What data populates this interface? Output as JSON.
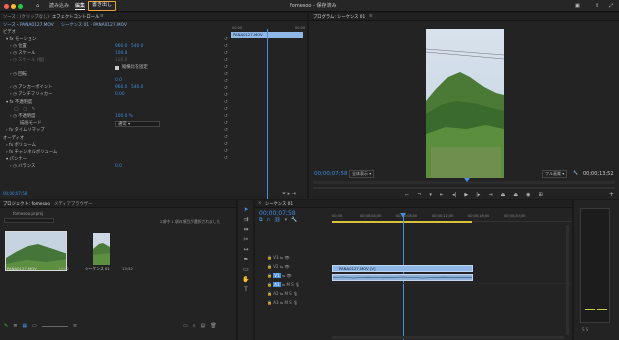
{
  "app": {
    "project_name": "fomesoo",
    "save_status": "保存済み",
    "title_combined": "fomesoo - 保存済み"
  },
  "menu": {
    "home_icon": "home-icon",
    "import_label": "読み込み",
    "edit_label": "編集",
    "export_label": "書き出し"
  },
  "effect_controls": {
    "tab_source": "ソース : (クリップなし)",
    "tab_effect": "エフェクトコントロール",
    "breadcrumb": "ソース・PANA0127.MOV",
    "sequence_ref": "シーケンス 01 · PANA0127.MOV",
    "time_start": "00:00",
    "time_end": "00:00",
    "clip_label": "PANA0127.MOV",
    "video_header": "ビデオ",
    "motion_label": "モーション",
    "position_label": "位置",
    "position_x": "960.0",
    "position_y": "540.0",
    "scale_label": "スケール",
    "scale_value": "100.0",
    "scale_width_label": "スケール (幅)",
    "scale_width_value": "100.0",
    "uniform_scale_label": "縦横比を固定",
    "rotation_label": "回転",
    "rotation_value": "0.0",
    "anchor_label": "アンカーポイント",
    "anchor_x": "960.0",
    "anchor_y": "540.0",
    "antiflicker_label": "アンチフリッカー",
    "antiflicker_value": "0.00",
    "opacity_label": "不透明度",
    "opacity_value_label": "不透明度",
    "opacity_value": "100.0 %",
    "blend_label": "描画モード",
    "blend_value": "通常",
    "time_remap_label": "タイムリマップ",
    "audio_header": "オーディオ",
    "volume_label": "ボリューム",
    "channel_volume_label": "チャンネルボリューム",
    "panner_label": "パンナー",
    "balance_label": "バランス",
    "balance_value": "0.0",
    "current_time": "00;00;07;58"
  },
  "program": {
    "title": "プログラム: シーケンス 01",
    "timecode": "00;00;07;58",
    "fit_label": "全体表示",
    "quality_label": "フル画質",
    "duration": "00;00;13;52"
  },
  "project": {
    "tab_project": "プロジェクト: fomesoo",
    "tab_media": "メディアブラウザー",
    "file_name": "fomesoo.prproj",
    "selection_status": "2項中 1 項の項目が選択されました",
    "items": [
      {
        "name": "PANA0127.MOV",
        "duration": "13;52"
      },
      {
        "name": "シーケンス 01",
        "duration": "13;52"
      }
    ]
  },
  "timeline": {
    "tab_label": "シーケンス 01",
    "timecode": "00;00;07;58",
    "ruler": [
      "00;00",
      "00;00;04;00",
      "00;00;08;00",
      "00;00;12;00",
      "00;00;16;00",
      "00;00;20;00"
    ],
    "video_tracks": [
      "V3",
      "V2",
      "V1"
    ],
    "audio_tracks": [
      "A1",
      "A2",
      "A3"
    ],
    "clip_label": "PANA0127.MOV [V]",
    "audio_clip_label": ""
  },
  "colors": {
    "accent_blue": "#4a90e2",
    "export_highlight": "#e7a23a",
    "video_clip": "#8fb8e6",
    "audio_clip": "#8fb0d8"
  }
}
